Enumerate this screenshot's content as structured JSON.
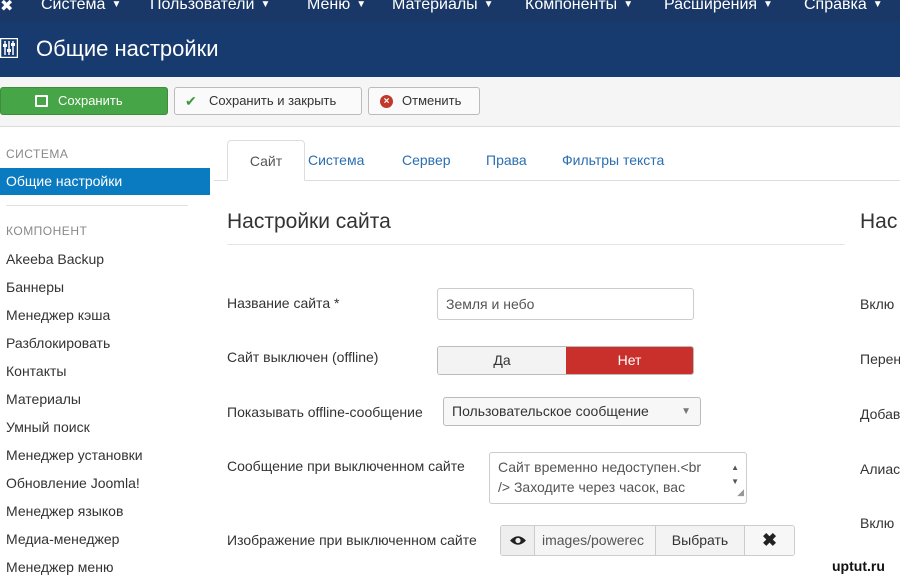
{
  "navbar": {
    "items": [
      "Система",
      "Пользователи",
      "Меню",
      "Материалы",
      "Компоненты",
      "Расширения",
      "Справка"
    ]
  },
  "titlebar": {
    "title": "Общие настройки"
  },
  "toolbar": {
    "save": "Сохранить",
    "save_close": "Сохранить и закрыть",
    "cancel": "Отменить"
  },
  "sidebar": {
    "system_header": "СИСТЕМА",
    "active_item": "Общие настройки",
    "component_header": "КОМПОНЕНТ",
    "items": [
      "Akeeba Backup",
      "Баннеры",
      "Менеджер кэша",
      "Разблокировать",
      "Контакты",
      "Материалы",
      "Умный поиск",
      "Менеджер установки",
      "Обновление Joomla!",
      "Менеджер языков",
      "Медиа-менеджер",
      "Менеджер меню"
    ]
  },
  "tabs": [
    "Сайт",
    "Система",
    "Сервер",
    "Права",
    "Фильтры текста"
  ],
  "section": {
    "title": "Настройки сайта",
    "title_right": "Нас"
  },
  "form": {
    "site_name_label": "Название сайта *",
    "site_name_value": "Земля и небо",
    "offline_label": "Сайт выключен (offline)",
    "offline_yes": "Да",
    "offline_no": "Нет",
    "offline_message_label": "Показывать offline-сообщение",
    "offline_message_value": "Пользовательское сообщение",
    "offline_text_label": "Сообщение при выключенном сайте",
    "offline_text_line1": "Сайт временно недоступен.<br",
    "offline_text_line2": "/> Заходите через часок, вас",
    "offline_image_label": "Изображение при выключенном сайте",
    "offline_image_path": "images/powerec",
    "offline_image_pick": "Выбрать",
    "offline_image_clear": "✖"
  },
  "right_labels": [
    "Вклю",
    "Перен",
    "Добав",
    "Алиас",
    "Вклю"
  ],
  "watermark": "uptut.ru"
}
